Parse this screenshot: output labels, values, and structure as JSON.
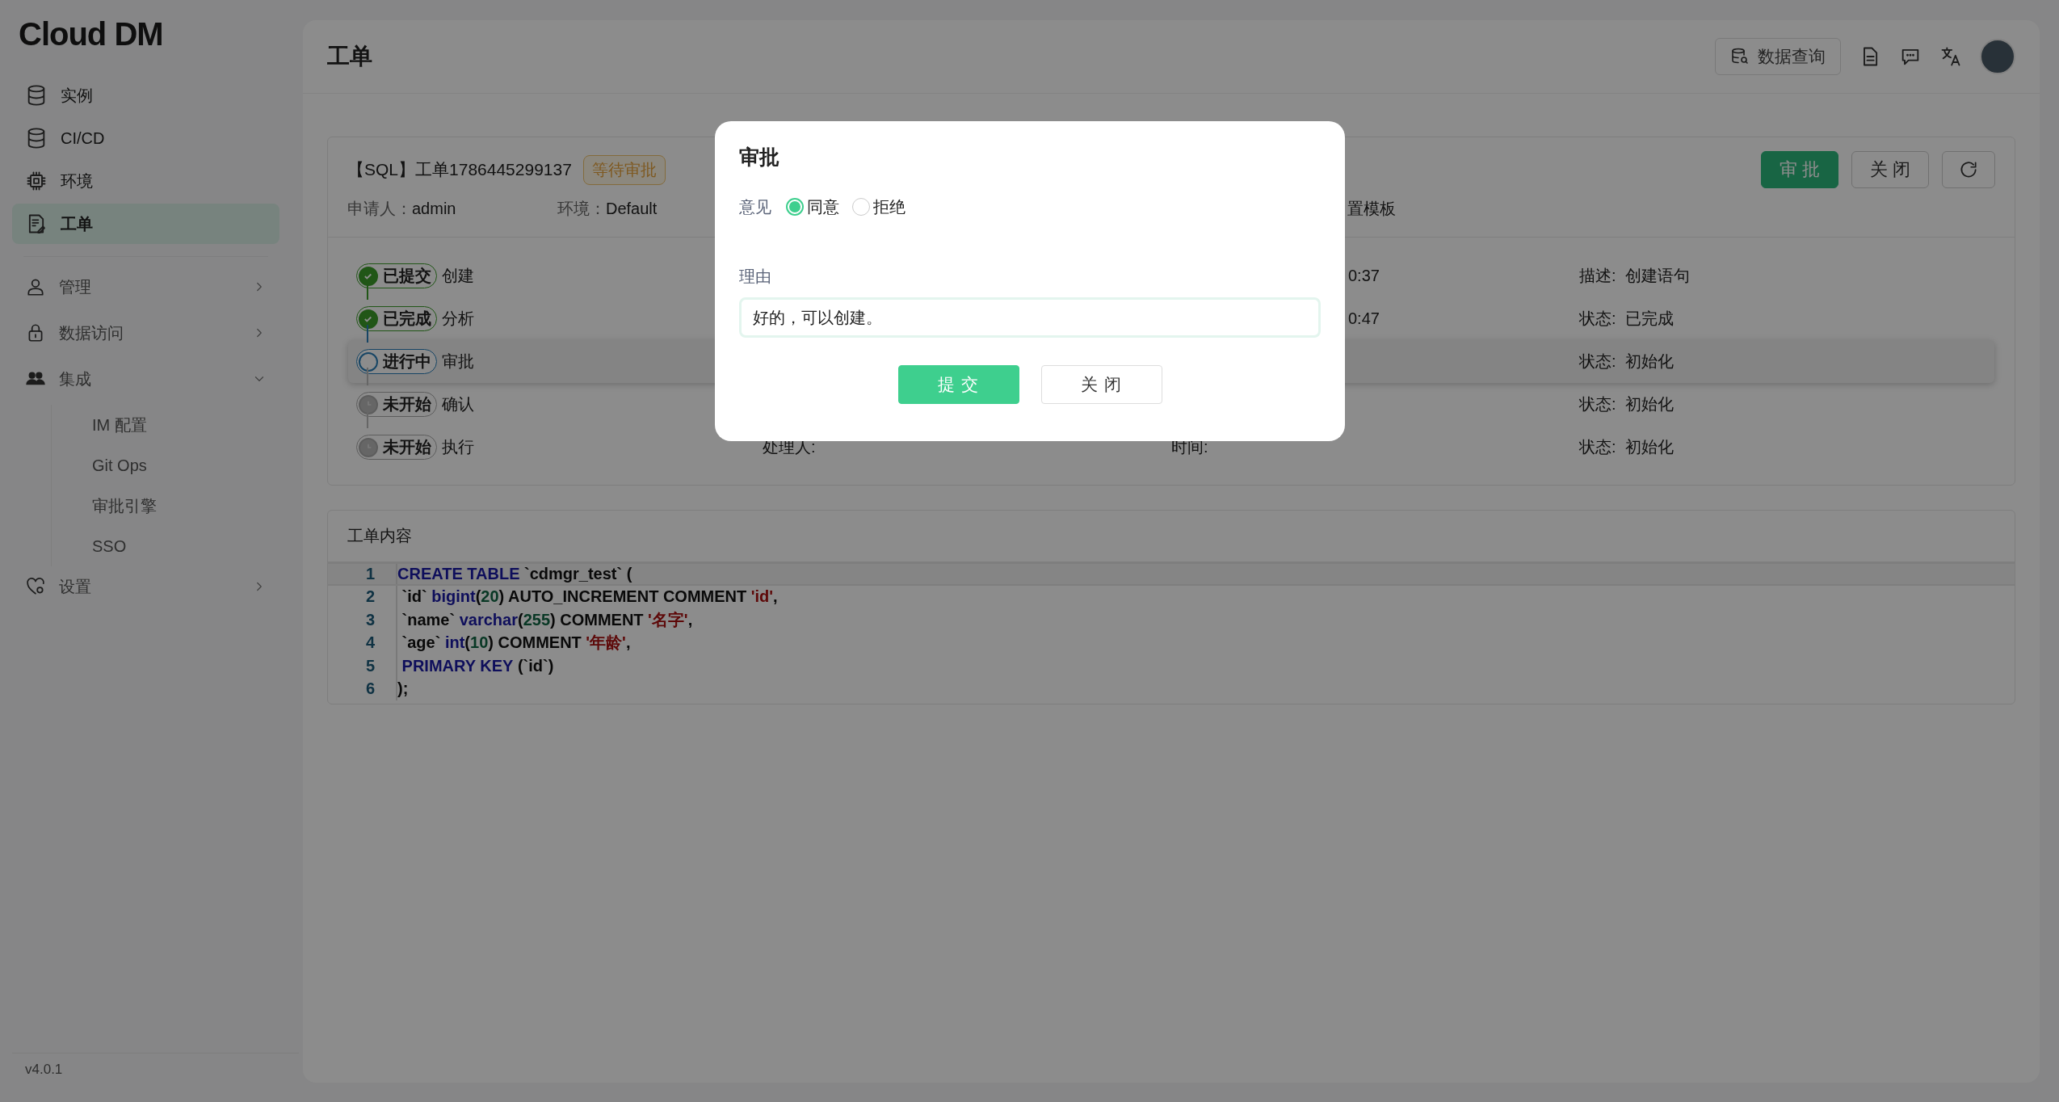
{
  "sidebar": {
    "logo": "Cloud DM",
    "items": [
      {
        "label": "实例",
        "selected": false
      },
      {
        "label": "CI/CD",
        "selected": false
      },
      {
        "label": "环境",
        "selected": false
      },
      {
        "label": "工单",
        "selected": true
      }
    ],
    "groups": [
      {
        "label": "管理",
        "expanded": false
      },
      {
        "label": "数据访问",
        "expanded": false
      },
      {
        "label": "集成",
        "expanded": true,
        "children": [
          {
            "label": "IM 配置"
          },
          {
            "label": "Git Ops"
          },
          {
            "label": "审批引擎"
          },
          {
            "label": "SSO"
          }
        ]
      },
      {
        "label": "设置",
        "expanded": false
      }
    ],
    "version": "v4.0.1"
  },
  "header": {
    "title": "工单",
    "query_button": "数据查询"
  },
  "ticket": {
    "title": "【SQL】工单1786445299137",
    "status_tag": "等待审批",
    "meta": [
      {
        "label": "申请人：",
        "value": "admin"
      },
      {
        "label": "环境：",
        "value": "Default"
      }
    ],
    "meta_fragment": "置模板",
    "buttons": [
      {
        "label": "审 批",
        "kind": "primary"
      },
      {
        "label": "关 闭",
        "kind": "default"
      }
    ],
    "steps": [
      {
        "kind": "done",
        "badge": "已提交",
        "name": "创建",
        "time": "0:37",
        "info_label": "描述:",
        "info_value": "创建语句",
        "selected": false
      },
      {
        "kind": "done",
        "badge": "已完成",
        "name": "分析",
        "time": "0:47",
        "info_label": "状态:",
        "info_value": "已完成",
        "selected": false
      },
      {
        "kind": "active",
        "badge": "进行中",
        "name": "审批",
        "info_label": "状态:",
        "info_value": "初始化",
        "selected": true
      },
      {
        "kind": "pending",
        "badge": "未开始",
        "name": "确认",
        "info_label": "状态:",
        "info_value": "初始化",
        "selected": false
      },
      {
        "kind": "pending",
        "badge": "未开始",
        "name": "执行",
        "handler_label": "处理人:",
        "time_label": "时间:",
        "info_label": "状态:",
        "info_value": "初始化",
        "selected": false
      }
    ]
  },
  "content": {
    "title": "工单内容",
    "lines": [
      {
        "number": "1",
        "active": true,
        "tokens": [
          {
            "kind": "keyword",
            "text": "CREATE TABLE"
          },
          {
            "kind": "plain",
            "text": " `cdmgr_test` ("
          }
        ]
      },
      {
        "number": "2",
        "active": false,
        "tokens": [
          {
            "kind": "plain",
            "text": " `id` "
          },
          {
            "kind": "keyword",
            "text": "bigint"
          },
          {
            "kind": "plain",
            "text": "("
          },
          {
            "kind": "number",
            "text": "20"
          },
          {
            "kind": "plain",
            "text": ") AUTO_INCREMENT COMMENT "
          },
          {
            "kind": "string",
            "text": "'id'"
          },
          {
            "kind": "plain",
            "text": ","
          }
        ]
      },
      {
        "number": "3",
        "active": false,
        "tokens": [
          {
            "kind": "plain",
            "text": " `name` "
          },
          {
            "kind": "keyword",
            "text": "varchar"
          },
          {
            "kind": "plain",
            "text": "("
          },
          {
            "kind": "number",
            "text": "255"
          },
          {
            "kind": "plain",
            "text": ") COMMENT "
          },
          {
            "kind": "string",
            "text": "'名字'"
          },
          {
            "kind": "plain",
            "text": ","
          }
        ]
      },
      {
        "number": "4",
        "active": false,
        "tokens": [
          {
            "kind": "plain",
            "text": " `age` "
          },
          {
            "kind": "keyword",
            "text": "int"
          },
          {
            "kind": "plain",
            "text": "("
          },
          {
            "kind": "number",
            "text": "10"
          },
          {
            "kind": "plain",
            "text": ") COMMENT "
          },
          {
            "kind": "string",
            "text": "'年龄'"
          },
          {
            "kind": "plain",
            "text": ","
          }
        ]
      },
      {
        "number": "5",
        "active": false,
        "tokens": [
          {
            "kind": "keyword",
            "text": " PRIMARY KEY"
          },
          {
            "kind": "plain",
            "text": " (`id`)"
          }
        ]
      },
      {
        "number": "6",
        "active": false,
        "tokens": [
          {
            "kind": "plain",
            "text": ");"
          }
        ]
      }
    ]
  },
  "dialog": {
    "title": "审批",
    "opinion_label": "意见",
    "options": [
      {
        "label": "同意",
        "selected": true
      },
      {
        "label": "拒绝",
        "selected": false
      }
    ],
    "reason_label": "理由",
    "reason_value": "好的，可以创建。",
    "buttons": [
      {
        "label": "提 交",
        "kind": "primary"
      },
      {
        "label": "关 闭",
        "kind": "default"
      }
    ]
  }
}
